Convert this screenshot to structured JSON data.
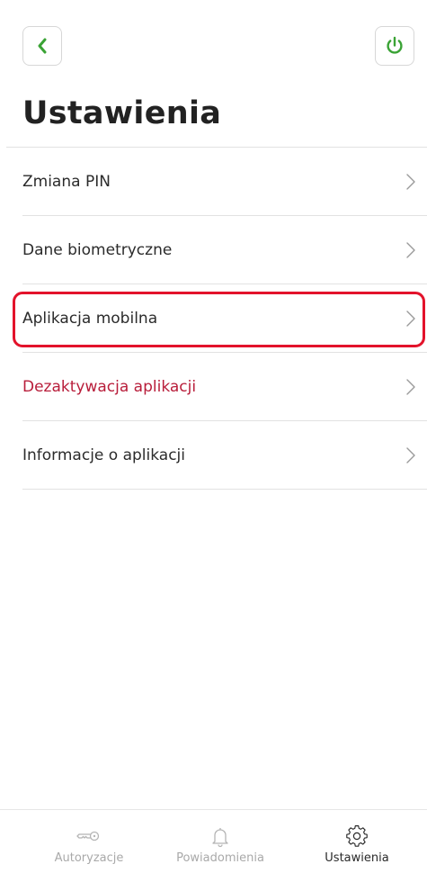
{
  "header": {
    "title": "Ustawienia"
  },
  "menu": {
    "items": [
      {
        "label": "Zmiana PIN"
      },
      {
        "label": "Dane biometryczne"
      },
      {
        "label": "Aplikacja mobilna"
      },
      {
        "label": "Dezaktywacja aplikacji"
      },
      {
        "label": "Informacje o aplikacji"
      }
    ]
  },
  "bottom_nav": {
    "items": [
      {
        "label": "Autoryzacje",
        "icon": "key-icon"
      },
      {
        "label": "Powiadomienia",
        "icon": "bell-icon"
      },
      {
        "label": "Ustawienia",
        "icon": "gear-icon",
        "active": true
      }
    ]
  },
  "colors": {
    "accent": "#3aa335",
    "danger": "#b81d3a",
    "highlight": "#e3132b"
  }
}
